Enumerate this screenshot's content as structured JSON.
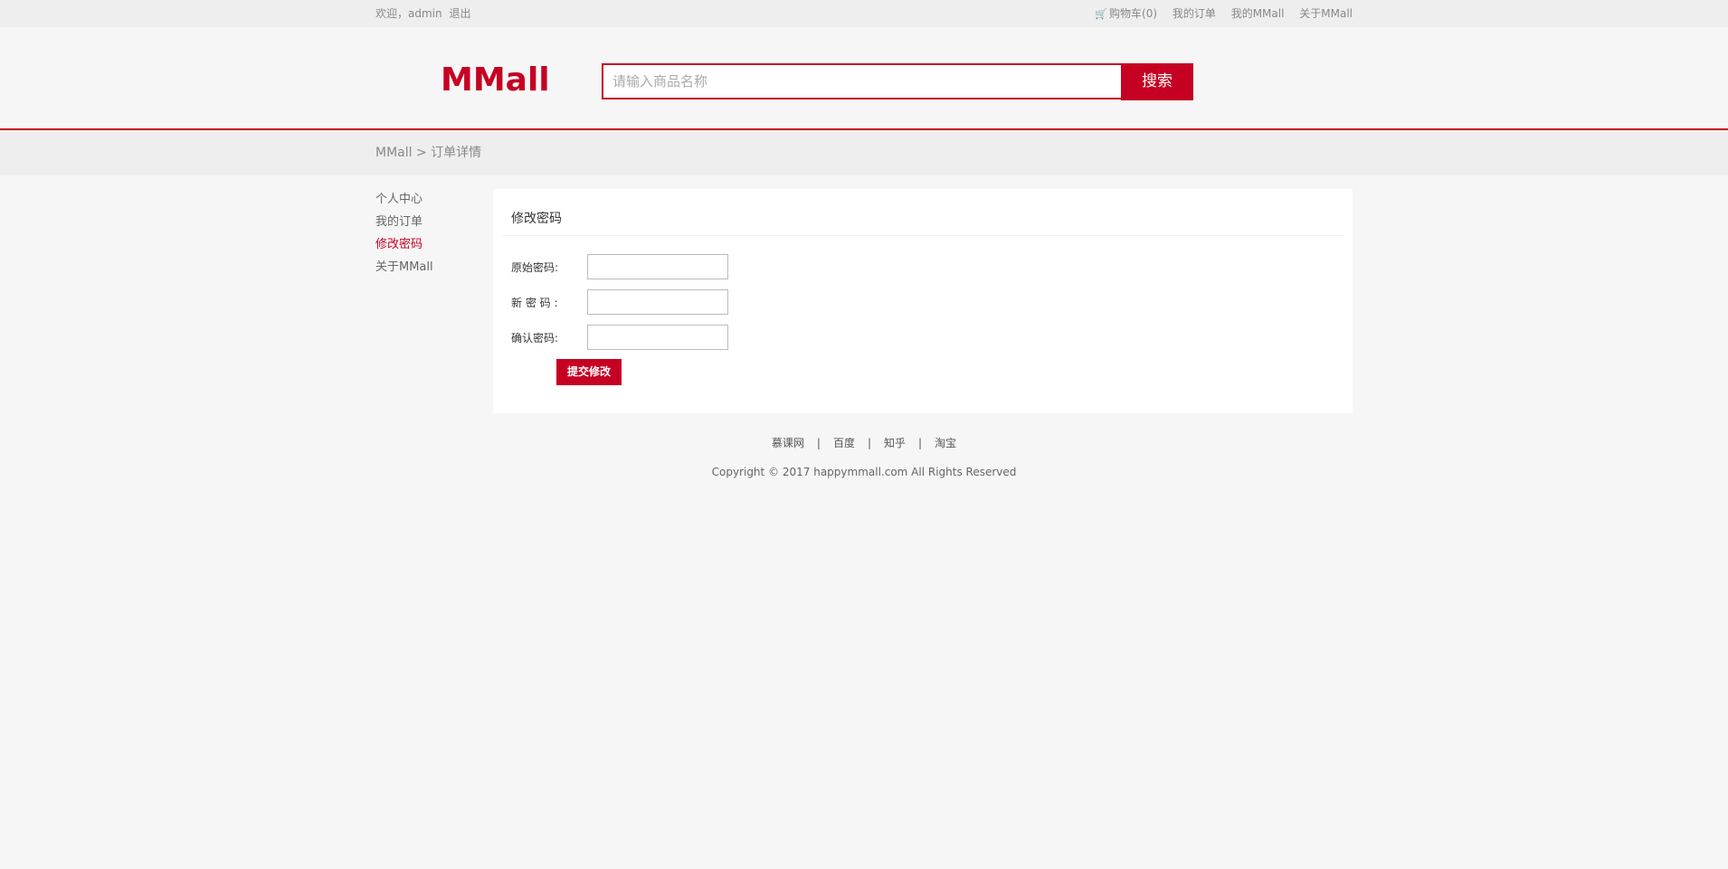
{
  "nav": {
    "welcome": "欢迎，admin",
    "logout": "退出",
    "cart": "购物车(0)",
    "my_orders": "我的订单",
    "my_mmall": "我的MMall",
    "about": "关于MMall"
  },
  "header": {
    "logo": "MMall",
    "search_placeholder": "请输入商品名称",
    "search_button": "搜索"
  },
  "crumb": {
    "text": "MMall > 订单详情"
  },
  "side": {
    "items": [
      {
        "label": "个人中心",
        "active": false
      },
      {
        "label": "我的订单",
        "active": false
      },
      {
        "label": "修改密码",
        "active": true
      },
      {
        "label": "关于MMall",
        "active": false
      }
    ]
  },
  "panel": {
    "title": "修改密码",
    "fields": [
      {
        "label": "原始密码:",
        "value": ""
      },
      {
        "label": "新 密 码 :",
        "value": ""
      },
      {
        "label": "确认密码:",
        "value": ""
      }
    ],
    "submit": "提交修改"
  },
  "footer": {
    "links": [
      "慕课网",
      "百度",
      "知乎",
      "淘宝"
    ],
    "separator": "|",
    "copyright": "Copyright © 2017 happymmall.com All Rights Reserved"
  },
  "colors": {
    "accent": "#c60023",
    "nav_bg": "#eeeeee",
    "page_bg": "#f6f6f6"
  }
}
